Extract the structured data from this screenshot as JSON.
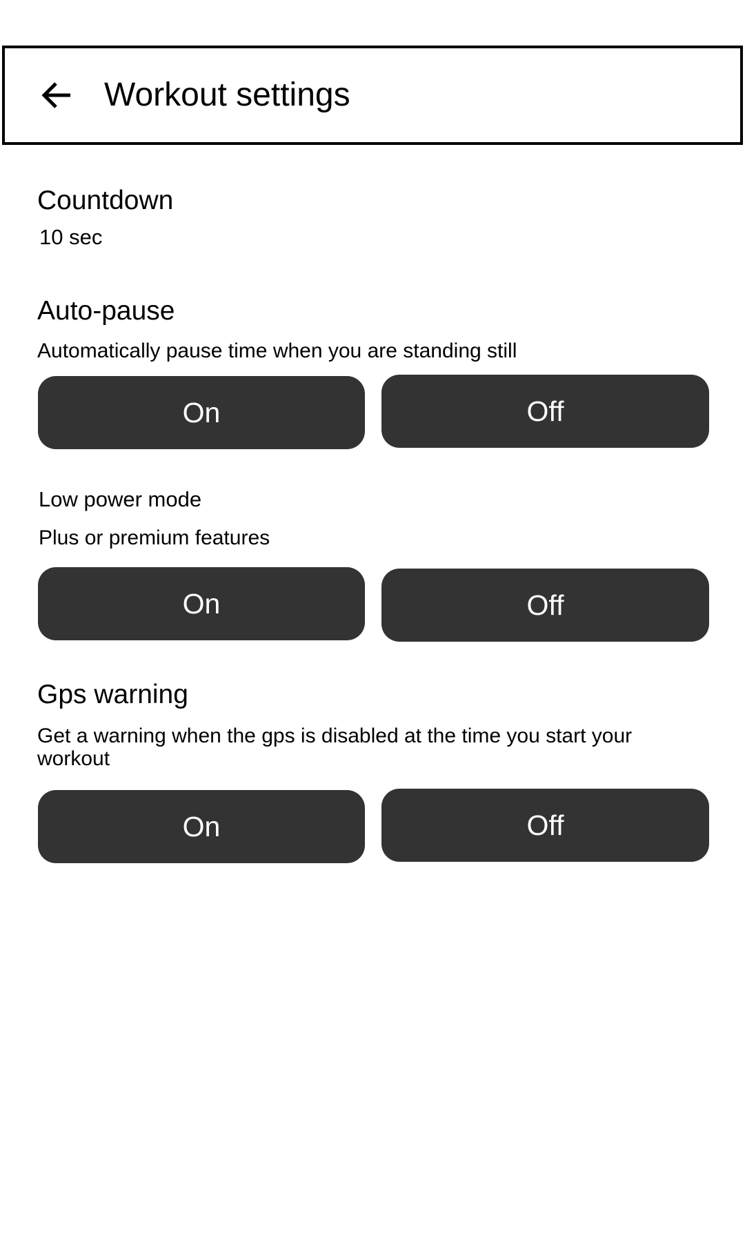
{
  "header": {
    "back_icon": "arrow-left-icon",
    "title": "Workout settings"
  },
  "settings": {
    "countdown": {
      "title": "Countdown",
      "value": "10 sec"
    },
    "auto_pause": {
      "title": "Auto-pause",
      "description": "Automatically pause time when you are standing still",
      "on_label": "On",
      "off_label": "Off"
    },
    "low_power": {
      "title": "Low power mode",
      "description": "Plus or premium features",
      "on_label": "On",
      "off_label": "Off"
    },
    "gps_warning": {
      "title": "Gps warning",
      "description": "Get a warning when the gps is disabled at the time you start your workout",
      "on_label": "On",
      "off_label": "Off"
    }
  },
  "colors": {
    "button_bg": "#333333",
    "button_text": "#ffffff",
    "header_border": "#000000"
  }
}
